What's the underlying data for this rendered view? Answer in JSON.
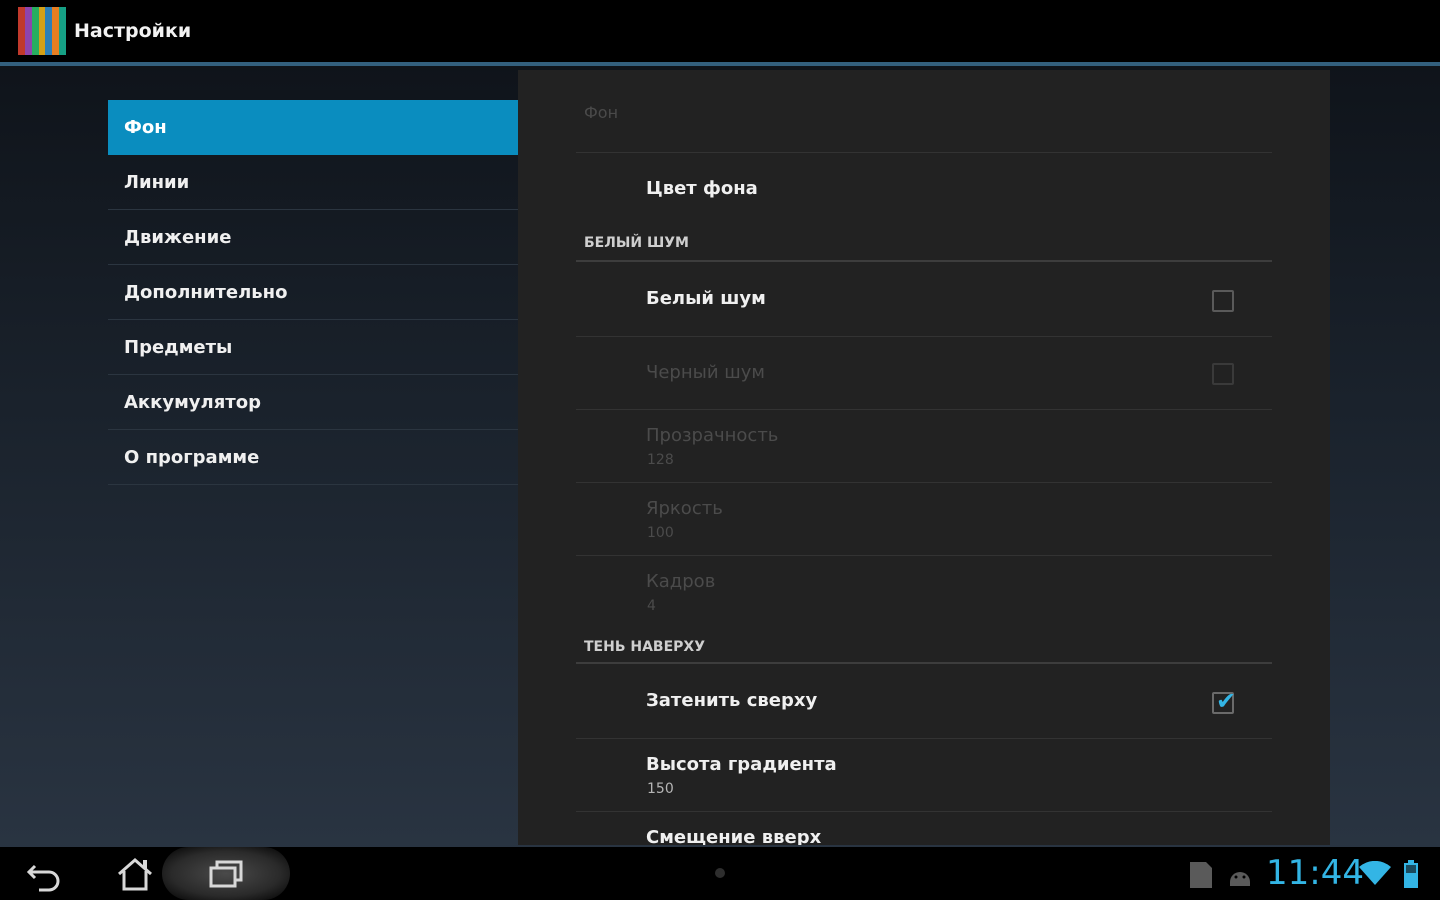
{
  "app": {
    "title": "Настройки",
    "icon": "app-stripes-icon",
    "icon_colors": [
      "#c0392b",
      "#8e44ad",
      "#27ae60",
      "#d4a017",
      "#2c7fb8",
      "#e67e22",
      "#16a085"
    ]
  },
  "colors": {
    "accent": "#0a8dbf",
    "holo_blue": "#33b5e5"
  },
  "nav": {
    "items": [
      {
        "label": "Фон",
        "selected": true
      },
      {
        "label": "Линии"
      },
      {
        "label": "Движение"
      },
      {
        "label": "Дополнительно"
      },
      {
        "label": "Предметы"
      },
      {
        "label": "Аккумулятор"
      },
      {
        "label": "О программе"
      }
    ]
  },
  "panel": {
    "title": "Фон",
    "color_row": {
      "title": "Цвет фона"
    },
    "section_white_noise": "БЕЛЫЙ ШУМ",
    "white_noise": {
      "title": "Белый шум",
      "checked": false
    },
    "black_noise": {
      "title": "Черный шум",
      "checked": false,
      "enabled": false
    },
    "opacity": {
      "title": "Прозрачность",
      "summary": "128",
      "enabled": false
    },
    "brightness": {
      "title": "Яркость",
      "summary": "100",
      "enabled": false
    },
    "frames": {
      "title": "Кадров",
      "summary": "4",
      "enabled": false
    },
    "section_top_shadow": "ТЕНЬ НАВЕРХУ",
    "shade_top": {
      "title": "Затенить сверху",
      "checked": true
    },
    "gradient_height": {
      "title": "Высота градиента",
      "summary": "150"
    },
    "next_row_partial": {
      "title": "Смещение вверх"
    }
  },
  "system_bar": {
    "back_icon": "back-icon",
    "home_icon": "home-icon",
    "recents_icon": "recents-icon",
    "clock": "11:44",
    "status_icons": [
      "sd-card-icon",
      "android-icon",
      "wifi-icon",
      "battery-icon"
    ]
  }
}
